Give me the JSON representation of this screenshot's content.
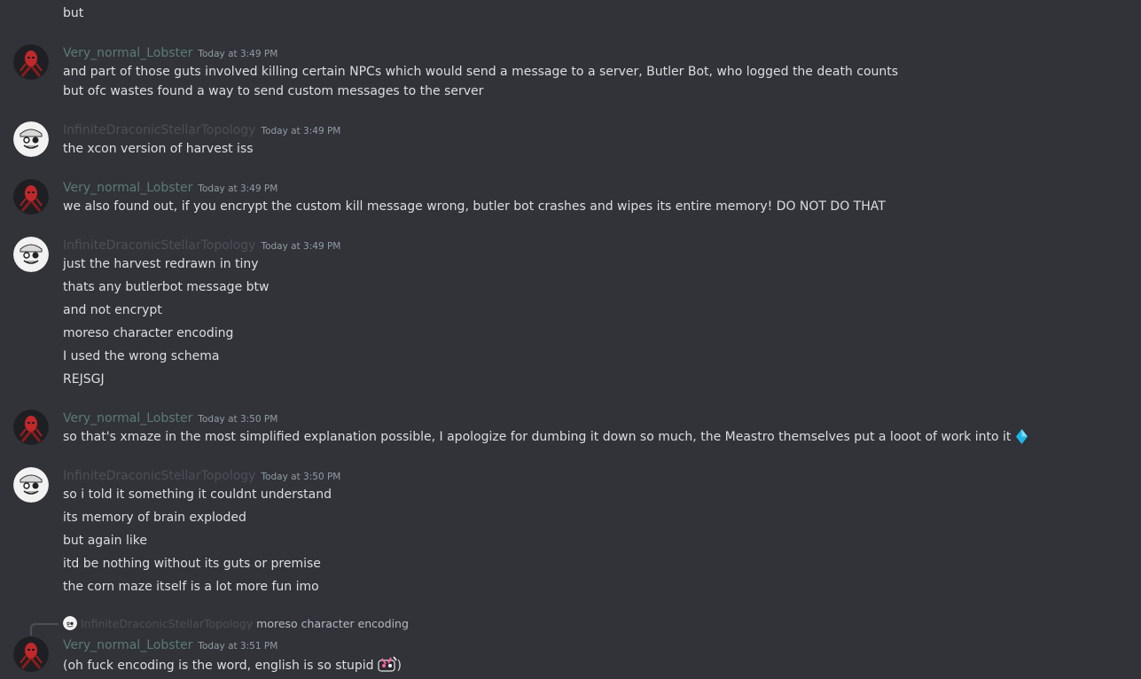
{
  "users": {
    "lobster": "Very_normal_Lobster",
    "topology": "InfiniteDraconicStellarTopology"
  },
  "colors": {
    "background": "#313338",
    "text": "#dbdee1",
    "lobster_name": "#5c7a74",
    "topology_name": "#4d4f56",
    "timestamp": "#949ba4",
    "emoji_diamond": "#1fb6e6"
  },
  "icons": {
    "lobster_avatar": "red-mask-avatar-icon",
    "topology_avatar": "grinning-face-avatar-icon",
    "diamond": "blue-diamond-emoji-icon",
    "custom_emoji": "custom-character-emoji-icon"
  },
  "top_line": "but",
  "groups": [
    {
      "author": "Very_normal_Lobster",
      "time": "Today at 3:49 PM",
      "lines": [
        "and part of those guts involved killing certain NPCs which would send a message to a server, Butler Bot, who logged the death counts",
        "but ofc wastes found a way to send custom messages to  the server"
      ]
    },
    {
      "author": "InfiniteDraconicStellarTopology",
      "time": "Today at 3:49 PM",
      "lines": [
        "the xcon version of harvest iss"
      ]
    },
    {
      "author": "Very_normal_Lobster",
      "time": "Today at 3:49 PM",
      "lines": [
        "we also found out, if you encrypt the custom kill message wrong, butler bot crashes and wipes its entire memory! DO NOT DO THAT"
      ]
    },
    {
      "author": "InfiniteDraconicStellarTopology",
      "time": "Today at 3:49 PM",
      "lines": [
        "just the harvest redrawn in tiny",
        "thats any butlerbot message btw",
        "and not encrypt",
        "moreso character encoding",
        "I used the wrong schema",
        "REJSGJ"
      ]
    },
    {
      "author": "Very_normal_Lobster",
      "time": "Today at 3:50 PM",
      "lines": [
        "so that's xmaze in the most simplified explanation possible, I apologize for dumbing it down so much, the Meastro themselves put a looot of work into it"
      ]
    },
    {
      "author": "InfiniteDraconicStellarTopology",
      "time": "Today at 3:50 PM",
      "lines": [
        "so i told it something it couldnt understand",
        "its memory of brain exploded",
        "but again like",
        "itd be nothing without its guts or premise",
        "the corn maze itself is a lot more fun imo"
      ]
    },
    {
      "author": "Very_normal_Lobster",
      "time": "Today at 3:51 PM",
      "reply_to": {
        "author": "InfiniteDraconicStellarTopology",
        "text": "moreso character encoding"
      },
      "lines": [
        "(oh fuck encoding is the word, english is so stupid",
        ")"
      ]
    }
  ]
}
